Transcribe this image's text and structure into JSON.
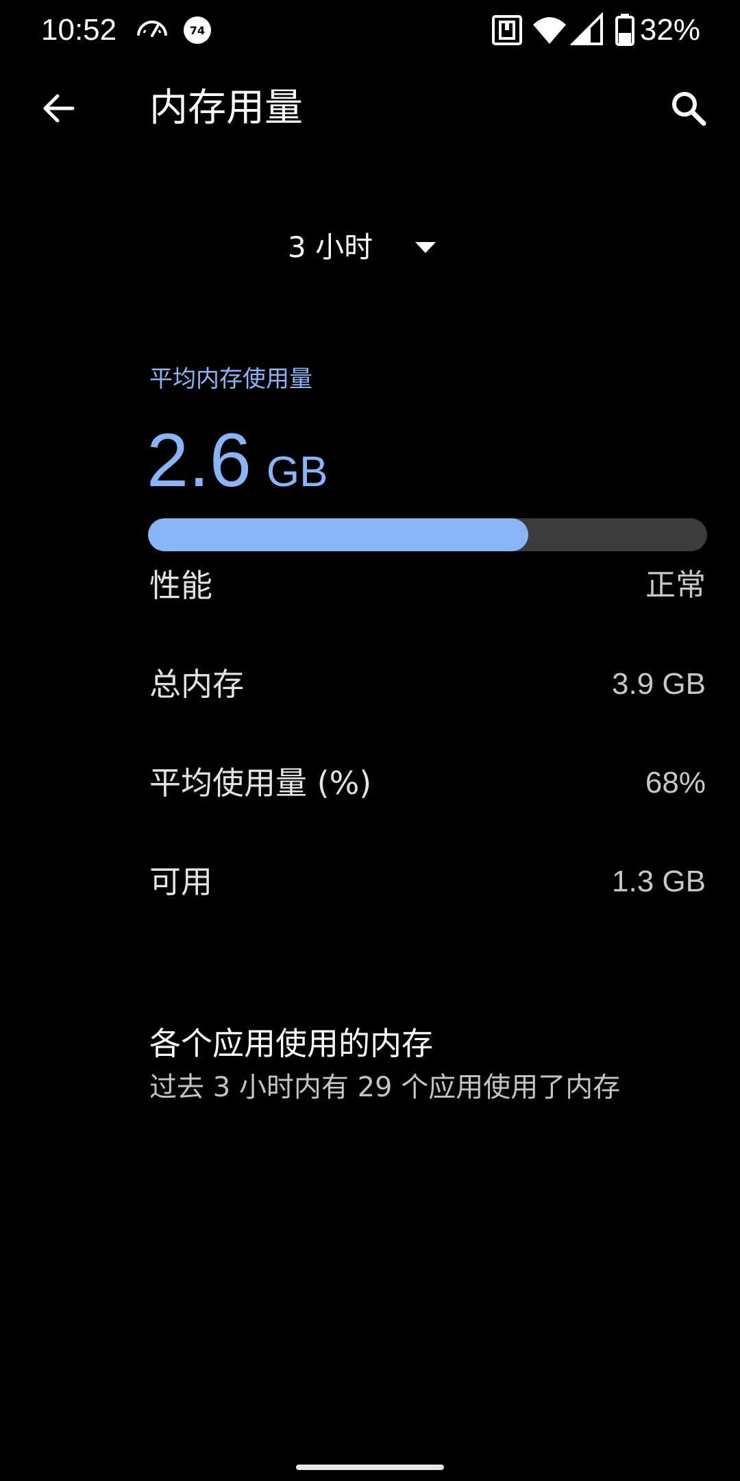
{
  "status_bar": {
    "time": "10:52",
    "badge_number": "74",
    "battery_percent": "32%",
    "icons": [
      "speedometer-icon",
      "notification-badge-icon",
      "nfc-icon",
      "wifi-icon",
      "cellular-signal-icon",
      "battery-icon"
    ]
  },
  "app_bar": {
    "title": "内存用量",
    "back_icon": "arrow-back-icon",
    "search_icon": "search-icon"
  },
  "range_selector": {
    "selected": "3 小时",
    "icon": "dropdown-arrow-icon"
  },
  "summary": {
    "avg_label": "平均内存使用量",
    "avg_value": "2.6",
    "avg_unit": "GB",
    "usage_fraction": 0.68
  },
  "details": [
    {
      "label": "性能",
      "value": "正常"
    },
    {
      "label": "总内存",
      "value": "3.9 GB"
    },
    {
      "label": "平均使用量 (%)",
      "value": "68%"
    },
    {
      "label": "可用",
      "value": "1.3 GB"
    }
  ],
  "apps": {
    "title": "各个应用使用的内存",
    "subtitle": "过去 3 小时内有 29 个应用使用了内存"
  },
  "colors": {
    "accent": "#8ab4f8",
    "background": "#000000",
    "track": "#3c3c3c"
  }
}
